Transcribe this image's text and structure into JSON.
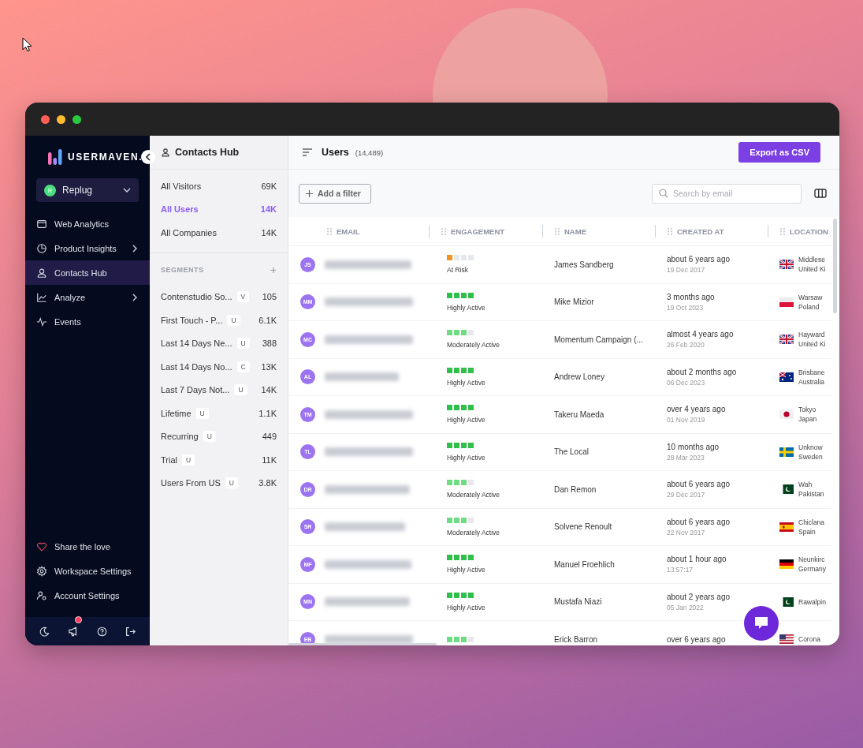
{
  "sidebar": {
    "logo": "USERMAVEN.",
    "workspace": {
      "initial": "R",
      "name": "Replug"
    },
    "nav": [
      {
        "label": "Web Analytics",
        "selected": false,
        "has_submenu": false
      },
      {
        "label": "Product Insights",
        "selected": false,
        "has_submenu": true
      },
      {
        "label": "Contacts Hub",
        "selected": true,
        "has_submenu": false
      },
      {
        "label": "Analyze",
        "selected": false,
        "has_submenu": true
      },
      {
        "label": "Events",
        "selected": false,
        "has_submenu": false
      }
    ],
    "bottom": [
      "Share the love",
      "Workspace Settings",
      "Account Settings"
    ]
  },
  "contacts_panel": {
    "title": "Contacts Hub",
    "views": [
      {
        "label": "All Visitors",
        "count": "69K",
        "selected": false
      },
      {
        "label": "All Users",
        "count": "14K",
        "selected": true
      },
      {
        "label": "All Companies",
        "count": "14K",
        "selected": false
      }
    ],
    "segments_heading": "SEGMENTS",
    "add_segment": "+",
    "segments": [
      {
        "label": "Contenstudio So...",
        "type": "V",
        "count": "105"
      },
      {
        "label": "First Touch - P...",
        "type": "U",
        "count": "6.1K"
      },
      {
        "label": "Last 14 Days Ne...",
        "type": "U",
        "count": "388"
      },
      {
        "label": "Last 14 Days No...",
        "type": "C",
        "count": "13K"
      },
      {
        "label": "Last 7 Days Not...",
        "type": "U",
        "count": "14K"
      },
      {
        "label": "Lifetime",
        "type": "U",
        "count": "1.1K"
      },
      {
        "label": "Recurring",
        "type": "U",
        "count": "449"
      },
      {
        "label": "Trial",
        "type": "U",
        "count": "11K"
      },
      {
        "label": "Users From US",
        "type": "U",
        "count": "3.8K"
      }
    ]
  },
  "users": {
    "title": "Users",
    "count": "(14,489)",
    "export_button": "Export as CSV",
    "filter_button": "Add a filter",
    "search": {
      "placeholder": "Search by email"
    },
    "columns": [
      "EMAIL",
      "ENGAGEMENT",
      "NAME",
      "CREATED AT",
      "LOCATION"
    ],
    "rows": [
      {
        "initials": "JS",
        "name": "James Sandberg",
        "created": "about 6 years ago",
        "created_date": "19 Dec 2017",
        "city": "Middlese",
        "country": "United Ki",
        "engagement": {
          "level": 0.25,
          "kind": "at_risk",
          "label": "At Risk"
        }
      },
      {
        "initials": "MM",
        "name": "Mike Mizior",
        "created": "3 months ago",
        "created_date": "19 Oct 2023",
        "city": "Warsaw",
        "country": "Poland",
        "engagement": {
          "level": 1,
          "kind": "high",
          "label": "Highly Active"
        }
      },
      {
        "initials": "MC",
        "name": "Momentum Campaign (...",
        "created": "almost 4 years ago",
        "created_date": "26 Feb 2020",
        "city": "Hayward",
        "country": "United Ki",
        "engagement": {
          "level": 0.75,
          "kind": "moderate",
          "label": "Moderately Active"
        }
      },
      {
        "initials": "AL",
        "name": "Andrew Loney",
        "created": "about 2 months ago",
        "created_date": "06 Dec 2023",
        "city": "Brisbane",
        "country": "Australia",
        "engagement": {
          "level": 1,
          "kind": "high",
          "label": "Highly Active"
        }
      },
      {
        "initials": "TM",
        "name": "Takeru Maeda",
        "created": "over 4 years ago",
        "created_date": "01 Nov 2019",
        "city": "Tokyo",
        "country": "Japan",
        "engagement": {
          "level": 1,
          "kind": "high",
          "label": "Highly Active"
        }
      },
      {
        "initials": "TL",
        "name": "The Local",
        "created": "10 months ago",
        "created_date": "28 Mar 2023",
        "city": "Unknow",
        "country": "Sweden",
        "engagement": {
          "level": 1,
          "kind": "high",
          "label": "Highly Active"
        }
      },
      {
        "initials": "DR",
        "name": "Dan Remon",
        "created": "about 6 years ago",
        "created_date": "29 Dec 2017",
        "city": "Wah",
        "country": "Pakistan",
        "engagement": {
          "level": 0.75,
          "kind": "moderate",
          "label": "Moderately Active"
        }
      },
      {
        "initials": "SR",
        "name": "Solvene Renoult",
        "created": "about 6 years ago",
        "created_date": "22 Nov 2017",
        "city": "Chiclana",
        "country": "Spain",
        "engagement": {
          "level": 0.75,
          "kind": "moderate",
          "label": "Moderately Active"
        }
      },
      {
        "initials": "MF",
        "name": "Manuel Froehlich",
        "created": "about 1 hour ago",
        "created_date": "13:57:17",
        "city": "Neunkirc",
        "country": "Germany",
        "engagement": {
          "level": 1,
          "kind": "high",
          "label": "Highly Active"
        }
      },
      {
        "initials": "MN",
        "name": "Mustafa Niazi",
        "created": "about 2 years ago",
        "created_date": "05 Jan 2022",
        "city": "Rawalpin",
        "engagement": {
          "level": 1,
          "kind": "high",
          "label": "Highly Active"
        }
      },
      {
        "initials": "EB",
        "name": "Erick Barron",
        "created": "over 6 years ago",
        "city": "Corona",
        "engagement": {
          "level": 0.75,
          "kind": "moderate"
        }
      }
    ]
  }
}
